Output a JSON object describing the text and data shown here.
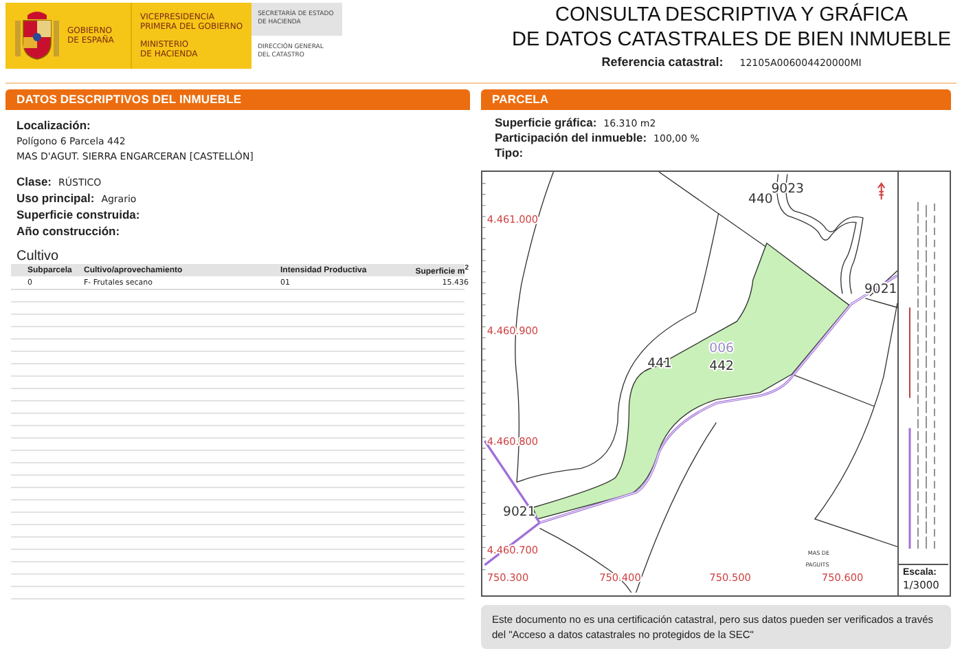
{
  "logo": {
    "government": [
      "GOBIERNO",
      "DE ESPAÑA"
    ],
    "vicepresidency": [
      "VICEPRESIDENCIA",
      "PRIMERA DEL GOBIERNO"
    ],
    "ministry": [
      "MINISTERIO",
      "DE HACIENDA"
    ],
    "secretariat": [
      "SECRETARÍA DE ESTADO",
      "DE HACIENDA"
    ],
    "directorate": [
      "DIRECCIÓN GENERAL",
      "DEL CATASTRO"
    ]
  },
  "title": [
    "CONSULTA DESCRIPTIVA Y GRÁFICA",
    "DE DATOS CATASTRALES DE BIEN INMUEBLE"
  ],
  "reference": {
    "label": "Referencia catastral:",
    "value": "12105A006004420000MI"
  },
  "descriptive": {
    "heading": "DATOS DESCRIPTIVOS DEL **INMUEBLE**",
    "location": {
      "label": "Localización:",
      "lines": [
        "Polígono 6 Parcela 442",
        "MAS D'AGUT. SIERRA ENGARCERAN [CASTELLÓN]"
      ]
    },
    "fields": [
      {
        "label": "Clase:",
        "value": "RÚSTICO"
      },
      {
        "label": "Uso principal:",
        "value": "Agrario"
      },
      {
        "label": "Superficie construida:"
      },
      {
        "label": "Año construcción:"
      }
    ],
    "crop_title": "Cultivo",
    "table": {
      "columns": [
        "Subparcela",
        "Cultivo/aprovechamiento",
        "Intensidad Productiva",
        "Superficie m$^{2}$"
      ],
      "rows": [
        [
          "0",
          "F- Frutales secano",
          "01",
          "15.436"
        ]
      ]
    }
  },
  "parcel": {
    "heading": "PARCELA",
    "fields": [
      {
        "label": "Superficie gráfica:",
        "value": "16.310 m2"
      },
      {
        "label": "Participación del inmueble:",
        "value": "100,00 %"
      },
      {
        "label": "Tipo:"
      }
    ],
    "map": {
      "y_ticks": [
        "4.461.000",
        "4.460.900",
        "4.460.800",
        "4.460.700"
      ],
      "x_ticks": [
        "750.300",
        "750.400",
        "750.500",
        "750.600"
      ],
      "labels": [
        "440",
        "9023",
        "9021",
        "006",
        "441",
        "442",
        "9021",
        "MAS DE",
        "PAGUITS"
      ],
      "scale_label": "Escala:",
      "scale_value": "1/3000"
    }
  },
  "note": "Este documento no es una certificación catastral, pero sus datos pueden ser verificados a través del \"Acceso a datos catastrales no protegidos de la SEC\""
}
